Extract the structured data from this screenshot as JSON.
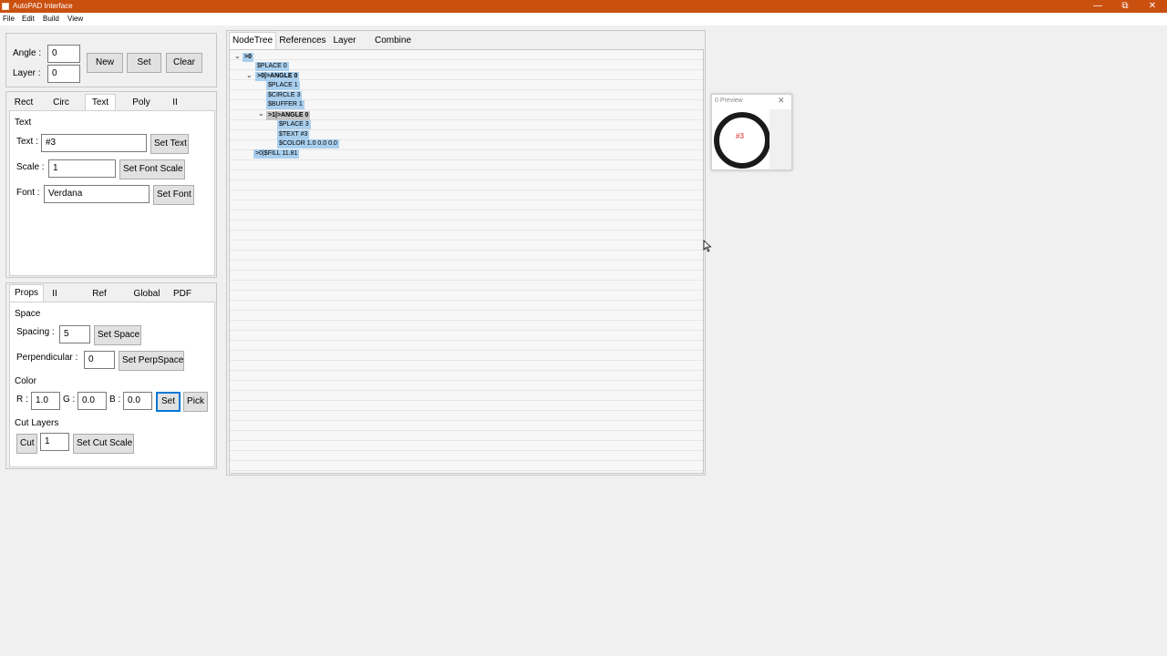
{
  "window": {
    "title": "AutoPAD Interface",
    "controls": {
      "minimize": "—",
      "restore": "⧉",
      "close": "✕"
    }
  },
  "menu": [
    "File",
    "Edit",
    "Build",
    "View"
  ],
  "top": {
    "angle_label": "Angle :",
    "angle_value": "0",
    "layer_label": "Layer :",
    "layer_value": "0",
    "new": "New",
    "set": "Set",
    "clear": "Clear"
  },
  "shape_tabs": {
    "tabs": [
      "Rect",
      "Circ",
      "Text",
      "Poly",
      "II"
    ],
    "active": "Text",
    "group": "Text",
    "text_label": "Text :",
    "text_value": "#3",
    "set_text": "Set Text",
    "scale_label": "Scale :",
    "scale_value": "1",
    "set_font_scale": "Set Font Scale",
    "font_label": "Font :",
    "font_value": "Verdana",
    "set_font": "Set Font"
  },
  "props_tabs": {
    "tabs": [
      "Props",
      "II",
      "Ref",
      "Global",
      "PDF"
    ],
    "active": "Props",
    "space_group": "Space",
    "spacing_label": "Spacing :",
    "spacing_value": "5",
    "set_space": "Set Space",
    "perp_label": "Perpendicular :",
    "perp_value": "0",
    "set_perp": "Set PerpSpace",
    "color_group": "Color",
    "r_label": "R :",
    "r_value": "1.0",
    "g_label": "G :",
    "g_value": "0.0",
    "b_label": "B :",
    "b_value": "0.0",
    "set": "Set",
    "pick": "Pick",
    "cut_group": "Cut Layers",
    "cut": "Cut",
    "cut_value": "1",
    "set_cut_scale": "Set Cut Scale"
  },
  "tree_tabs": [
    "NodeTree",
    "References",
    "Layer",
    "Combine"
  ],
  "tree": {
    "chevron": "⌄",
    "nodes": [
      ">0",
      "$PLACE 0",
      ">0|>ANGLE 0",
      "$PLACE 1",
      "$CIRCLE 3",
      "$BUFFER 1",
      ">1|>ANGLE 0",
      "$PLACE 3",
      "$TEXT #3",
      "$COLOR 1.0 0.0 0.0",
      ">0|$FILL 11.81"
    ]
  },
  "preview": {
    "title": "0 Preview",
    "close": "✕",
    "text": "#3"
  },
  "colors": {
    "titlebar": "#ca5010",
    "tree_highlight": "#a9cfee",
    "preview_text": "#e02020",
    "focus": "#0078d7"
  }
}
